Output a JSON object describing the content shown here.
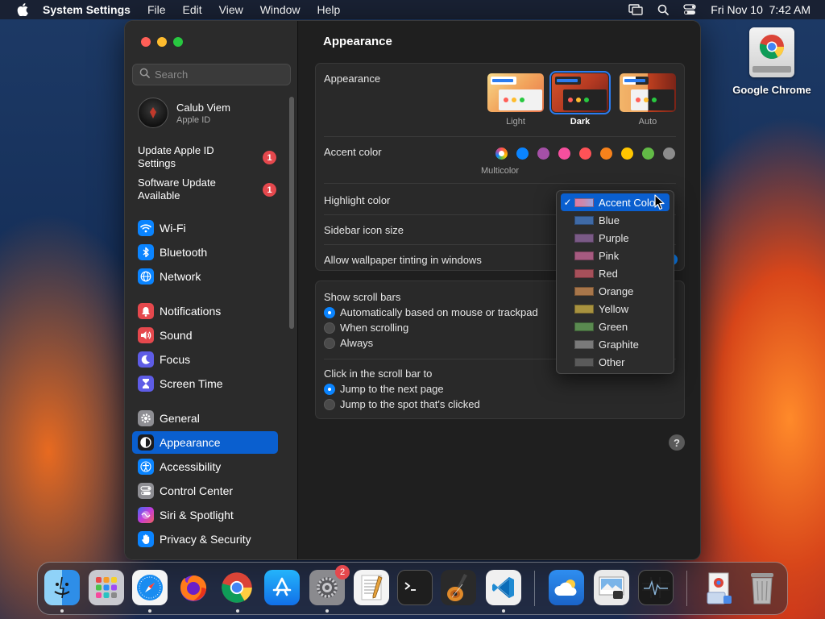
{
  "menubar": {
    "app_name": "System Settings",
    "menus": [
      "File",
      "Edit",
      "View",
      "Window",
      "Help"
    ],
    "datetime": "Fri Nov 10  7:42 AM"
  },
  "desktop": {
    "icons": [
      {
        "label": "Google Chrome",
        "icon": "chrome-icon"
      }
    ]
  },
  "sidebar": {
    "search_placeholder": "Search",
    "account": {
      "name": "Calub Viem",
      "subtitle": "Apple ID"
    },
    "alerts": [
      {
        "line1": "Update Apple ID",
        "line2": "Settings",
        "badge": "1"
      },
      {
        "line1": "Software Update",
        "line2": "Available",
        "badge": "1"
      }
    ],
    "items": [
      {
        "label": "Wi-Fi",
        "icon": "wifi-icon",
        "color": "#0a84ff"
      },
      {
        "label": "Bluetooth",
        "icon": "bluetooth-icon",
        "color": "#0a84ff"
      },
      {
        "label": "Network",
        "icon": "globe-icon",
        "color": "#0a84ff"
      },
      {
        "label": "Notifications",
        "icon": "bell-icon",
        "color": "#e5484d"
      },
      {
        "label": "Sound",
        "icon": "speaker-icon",
        "color": "#e5484d"
      },
      {
        "label": "Focus",
        "icon": "moon-icon",
        "color": "#5e5ce6"
      },
      {
        "label": "Screen Time",
        "icon": "hourglass-icon",
        "color": "#5e5ce6"
      },
      {
        "label": "General",
        "icon": "gear-icon",
        "color": "#8e8e93"
      },
      {
        "label": "Appearance",
        "icon": "appearance-icon",
        "color": "#1c1c1e"
      },
      {
        "label": "Accessibility",
        "icon": "accessibility-icon",
        "color": "#0a84ff"
      },
      {
        "label": "Control Center",
        "icon": "control-center-icon",
        "color": "#8e8e93"
      },
      {
        "label": "Siri & Spotlight",
        "icon": "siri-icon",
        "color": "#bf5af2"
      },
      {
        "label": "Privacy & Security",
        "icon": "hand-icon",
        "color": "#0a84ff"
      }
    ],
    "selected": "Appearance"
  },
  "main": {
    "title": "Appearance",
    "appearance": {
      "label": "Appearance",
      "options": [
        {
          "label": "Light",
          "selected": false
        },
        {
          "label": "Dark",
          "selected": true
        },
        {
          "label": "Auto",
          "selected": false
        }
      ]
    },
    "accent": {
      "label": "Accent color",
      "caption": "Multicolor",
      "colors": [
        "multicolor",
        "#0a84ff",
        "#a550a7",
        "#f74f9e",
        "#ff5257",
        "#f7821b",
        "#ffc600",
        "#62ba46",
        "#8c8c8c"
      ]
    },
    "highlight": {
      "label": "Highlight color"
    },
    "sidebar_icon_size": {
      "label": "Sidebar icon size"
    },
    "wallpaper_tinting": {
      "label": "Allow wallpaper tinting in windows"
    },
    "scroll_bars": {
      "label": "Show scroll bars",
      "options": [
        {
          "label": "Automatically based on mouse or trackpad",
          "selected": true
        },
        {
          "label": "When scrolling",
          "selected": false
        },
        {
          "label": "Always",
          "selected": false
        }
      ]
    },
    "click_scroll": {
      "label": "Click in the scroll bar to",
      "options": [
        {
          "label": "Jump to the next page",
          "selected": true
        },
        {
          "label": "Jump to the spot that's clicked",
          "selected": false
        }
      ]
    },
    "help": "?"
  },
  "highlight_dropdown": {
    "checkmark": "✓",
    "items": [
      {
        "label": "Accent Color",
        "swatch": "#c98bb0",
        "checked": true
      },
      {
        "label": "Blue",
        "swatch": "#3f6aa6",
        "checked": false
      },
      {
        "label": "Purple",
        "swatch": "#7a5a86",
        "checked": false
      },
      {
        "label": "Pink",
        "swatch": "#a65a80",
        "checked": false
      },
      {
        "label": "Red",
        "swatch": "#a6505a",
        "checked": false
      },
      {
        "label": "Orange",
        "swatch": "#a8764a",
        "checked": false
      },
      {
        "label": "Yellow",
        "swatch": "#a8923f",
        "checked": false
      },
      {
        "label": "Green",
        "swatch": "#5a8a50",
        "checked": false
      },
      {
        "label": "Graphite",
        "swatch": "#7a7a7a",
        "checked": false
      },
      {
        "label": "Other",
        "swatch": "#5a5a5a",
        "checked": false
      }
    ]
  },
  "dock": {
    "badge_settings": "2",
    "apps": [
      "finder-icon",
      "launchpad-icon",
      "safari-icon",
      "firefox-icon",
      "chrome-icon",
      "app-store-icon",
      "system-settings-icon",
      "textedit-icon",
      "terminal-icon",
      "garageband-icon",
      "vscode-icon",
      "weather-icon",
      "preview-icon",
      "activity-monitor-icon",
      "downloads-icon",
      "trash-icon"
    ]
  }
}
